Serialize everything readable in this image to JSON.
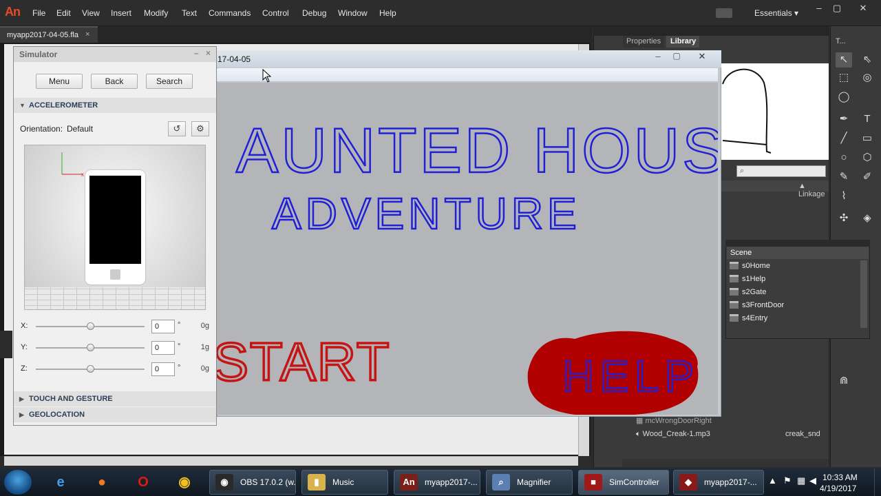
{
  "app": {
    "logo": "An",
    "menu": [
      "File",
      "Edit",
      "View",
      "Insert",
      "Modify",
      "Text",
      "Commands",
      "Control",
      "Debug",
      "Window",
      "Help"
    ],
    "workspace": "Essentials",
    "window_controls": [
      "–",
      "▢",
      "✕"
    ]
  },
  "document_tab": {
    "title": "myapp2017-04-05.fla",
    "close": "×"
  },
  "panels": {
    "properties_tab": "Properties",
    "library_tab": "Library",
    "library_column": "Linkage",
    "library_rows": [
      {
        "name": "mcWrongDoorRight",
        "linkage": ""
      },
      {
        "name": "Wood_Creak-1.mp3",
        "linkage": "creak_snd"
      }
    ],
    "tools_title": "T..."
  },
  "scene_panel": {
    "title": "Scene",
    "items": [
      "s0Home",
      "s1Help",
      "s2Gate",
      "s3FrontDoor",
      "s4Entry"
    ]
  },
  "simulator": {
    "title": "Simulator",
    "buttons": [
      "Menu",
      "Back",
      "Search"
    ],
    "accelerometer_label": "ACCELEROMETER",
    "orientation_label": "Orientation:",
    "orientation_value": "Default",
    "sliders": [
      {
        "label": "X:",
        "value": "0",
        "unit": "°",
        "g": "0g",
        "position": 0.5
      },
      {
        "label": "Y:",
        "value": "0",
        "unit": "°",
        "g": "1g",
        "position": 0.5
      },
      {
        "label": "Z:",
        "value": "0",
        "unit": "°",
        "g": "0g",
        "position": 0.5
      }
    ],
    "touch_label": "TOUCH AND GESTURE",
    "geolocation_label": "GEOLOCATION"
  },
  "player": {
    "title": "17-04-05",
    "min": "–",
    "max": "▢",
    "close": "✕",
    "stage": {
      "title_line1": "AUNTED HOUSE",
      "title_line2": "ADVENTURE",
      "start_label": "START",
      "help_label": "HELP",
      "ink_color": "#1f1fd6",
      "start_color": "#c41414",
      "help_blob_color": "#b00000",
      "background": "#b4b5b9"
    }
  },
  "taskbar": {
    "tasks": [
      {
        "label": "OBS 17.0.2 (w...",
        "glyph": "◉",
        "color": "#2a2a2a"
      },
      {
        "label": "Music",
        "glyph": "▮",
        "color": "#d8b24a"
      },
      {
        "label": "myapp2017-...",
        "glyph": "An",
        "color": "#7a1f1a"
      },
      {
        "label": "Magnifier",
        "glyph": "⌕",
        "color": "#5a7fb0"
      },
      {
        "label": "SimController",
        "glyph": "■",
        "color": "#a01818"
      },
      {
        "label": "myapp2017-...",
        "glyph": "◆",
        "color": "#8a1a1a"
      }
    ],
    "time": "10:33 AM",
    "date": "4/19/2017"
  }
}
